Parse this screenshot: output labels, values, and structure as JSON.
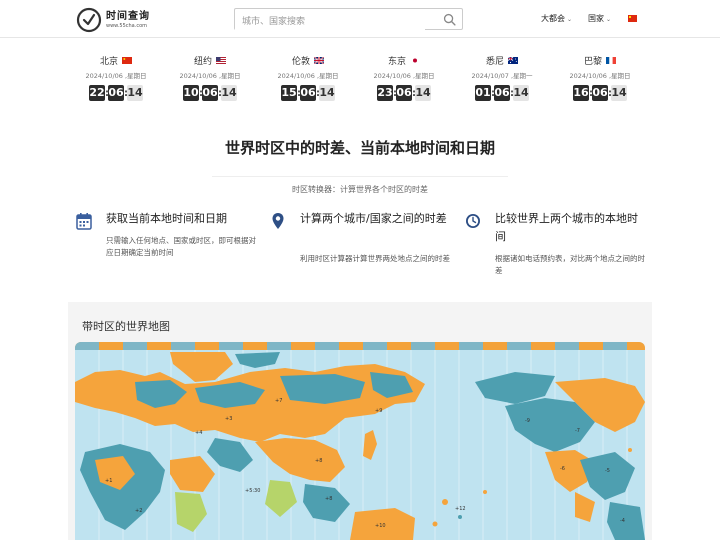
{
  "header": {
    "logo_name": "时间查询",
    "logo_url": "www.55cha.com",
    "search_placeholder": "城市、国家搜索",
    "nav_cities": "大都会",
    "nav_countries": "国家"
  },
  "clocks": [
    {
      "city": "北京",
      "date": "2024/10/06 ,星期日",
      "hh": "22",
      "mm": "06",
      "ss": "14",
      "flag": "china"
    },
    {
      "city": "纽约",
      "date": "2024/10/06 ,星期日",
      "hh": "10",
      "mm": "06",
      "ss": "14",
      "flag": "usa"
    },
    {
      "city": "伦敦",
      "date": "2024/10/06 ,星期日",
      "hh": "15",
      "mm": "06",
      "ss": "14",
      "flag": "uk"
    },
    {
      "city": "东京",
      "date": "2024/10/06 ,星期日",
      "hh": "23",
      "mm": "06",
      "ss": "14",
      "flag": "japan"
    },
    {
      "city": "悉尼",
      "date": "2024/10/07 ,星期一",
      "hh": "01",
      "mm": "06",
      "ss": "14",
      "flag": "australia"
    },
    {
      "city": "巴黎",
      "date": "2024/10/06 ,星期日",
      "hh": "16",
      "mm": "06",
      "ss": "14",
      "flag": "france"
    }
  ],
  "main": {
    "title": "世界时区中的时差、当前本地时间和日期",
    "subtitle": "时区转换器：计算世界各个时区的时差"
  },
  "features": [
    {
      "title": "获取当前本地时间和日期",
      "desc": "只需输入任何地点、国家或时区，即可根据对应日期确定当前时间",
      "icon": "calendar-icon"
    },
    {
      "title": "计算两个城市/国家之间的时差",
      "desc": "利用时区计算器计算世界两处地点之间的时差",
      "icon": "location-pin-icon"
    },
    {
      "title": "比较世界上两个城市的本地时间",
      "desc": "根据诸如电话预约表，对比两个地点之间的时差",
      "icon": "clock-icon"
    }
  ],
  "map": {
    "title": "带时区的世界地图",
    "colors": {
      "ocean": "#bfe3f0",
      "orange": "#f5a43c",
      "teal": "#4e9fb0",
      "green": "#b6d46a",
      "label": "#333333"
    }
  }
}
